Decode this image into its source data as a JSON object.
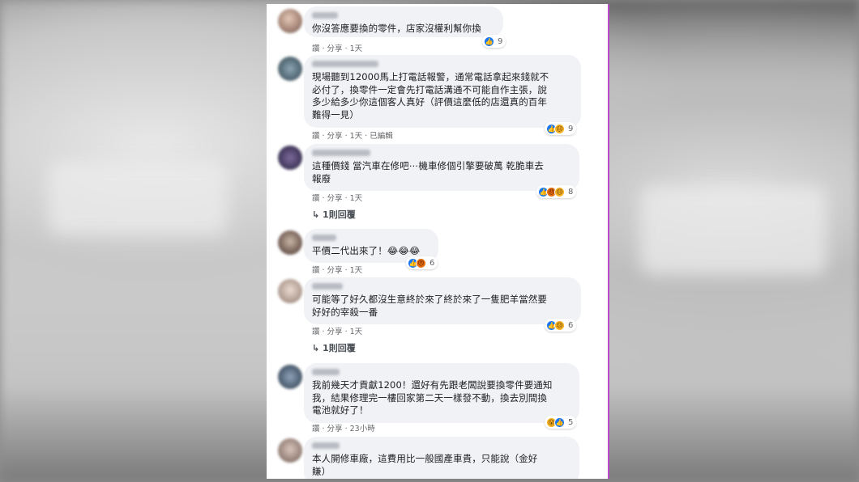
{
  "comments": [
    {
      "text": "你沒答應要換的零件，店家沒權利幫你換",
      "actions": "讚 · 分享 · 1天",
      "reaction_count": "9",
      "reactions": [
        "like"
      ]
    },
    {
      "text": "現場聽到12000馬上打電話報警，通常電話拿起來錢就不\n必付了，換零件一定會先打電話溝通不可能自作主張，說\n多少給多少你這個客人真好（評價這麼低的店還真的百年\n難得一見）",
      "actions": "讚 · 分享 · 1天 · 已編輯",
      "reaction_count": "9",
      "reactions": [
        "like",
        "sad"
      ]
    },
    {
      "text": "這種價錢 當汽車在修吧⋯機車修個引擎要破萬 乾脆車去\n報廢",
      "actions": "讚 · 分享 · 1天",
      "reaction_count": "8",
      "reactions": [
        "like",
        "angry",
        "sad"
      ],
      "replies": "↳ 1則回覆"
    },
    {
      "text": "平價二代出來了！😂😂😂",
      "actions": "讚 · 分享 · 1天",
      "reaction_count": "6",
      "reactions": [
        "like",
        "angry"
      ]
    },
    {
      "text": "可能等了好久都沒生意終於來了終於來了一隻肥羊當然要\n好好的宰殺一番",
      "actions": "讚 · 分享 · 1天",
      "reaction_count": "6",
      "reactions": [
        "like",
        "sad"
      ],
      "replies": "↳ 1則回覆"
    },
    {
      "text": "我前幾天才貢獻1200！還好有先跟老闆說要換零件要通知\n我，結果修理完一樓回家第二天一樣發不動，換去別間換\n電池就好了！",
      "actions": "讚 · 分享 · 23小時",
      "reaction_count": "5",
      "reactions": [
        "haha",
        "like"
      ]
    },
    {
      "text": "本人開修車廠，這費用比一般國產車貴，只能說（金好\n賺）",
      "actions": "",
      "reaction_count": "",
      "reactions": []
    }
  ],
  "colors": {
    "like": "#1877f2",
    "reaction_yellow": "#f7b125",
    "bubble": "#f0f2f5",
    "panel_border": "#b84bc9"
  }
}
